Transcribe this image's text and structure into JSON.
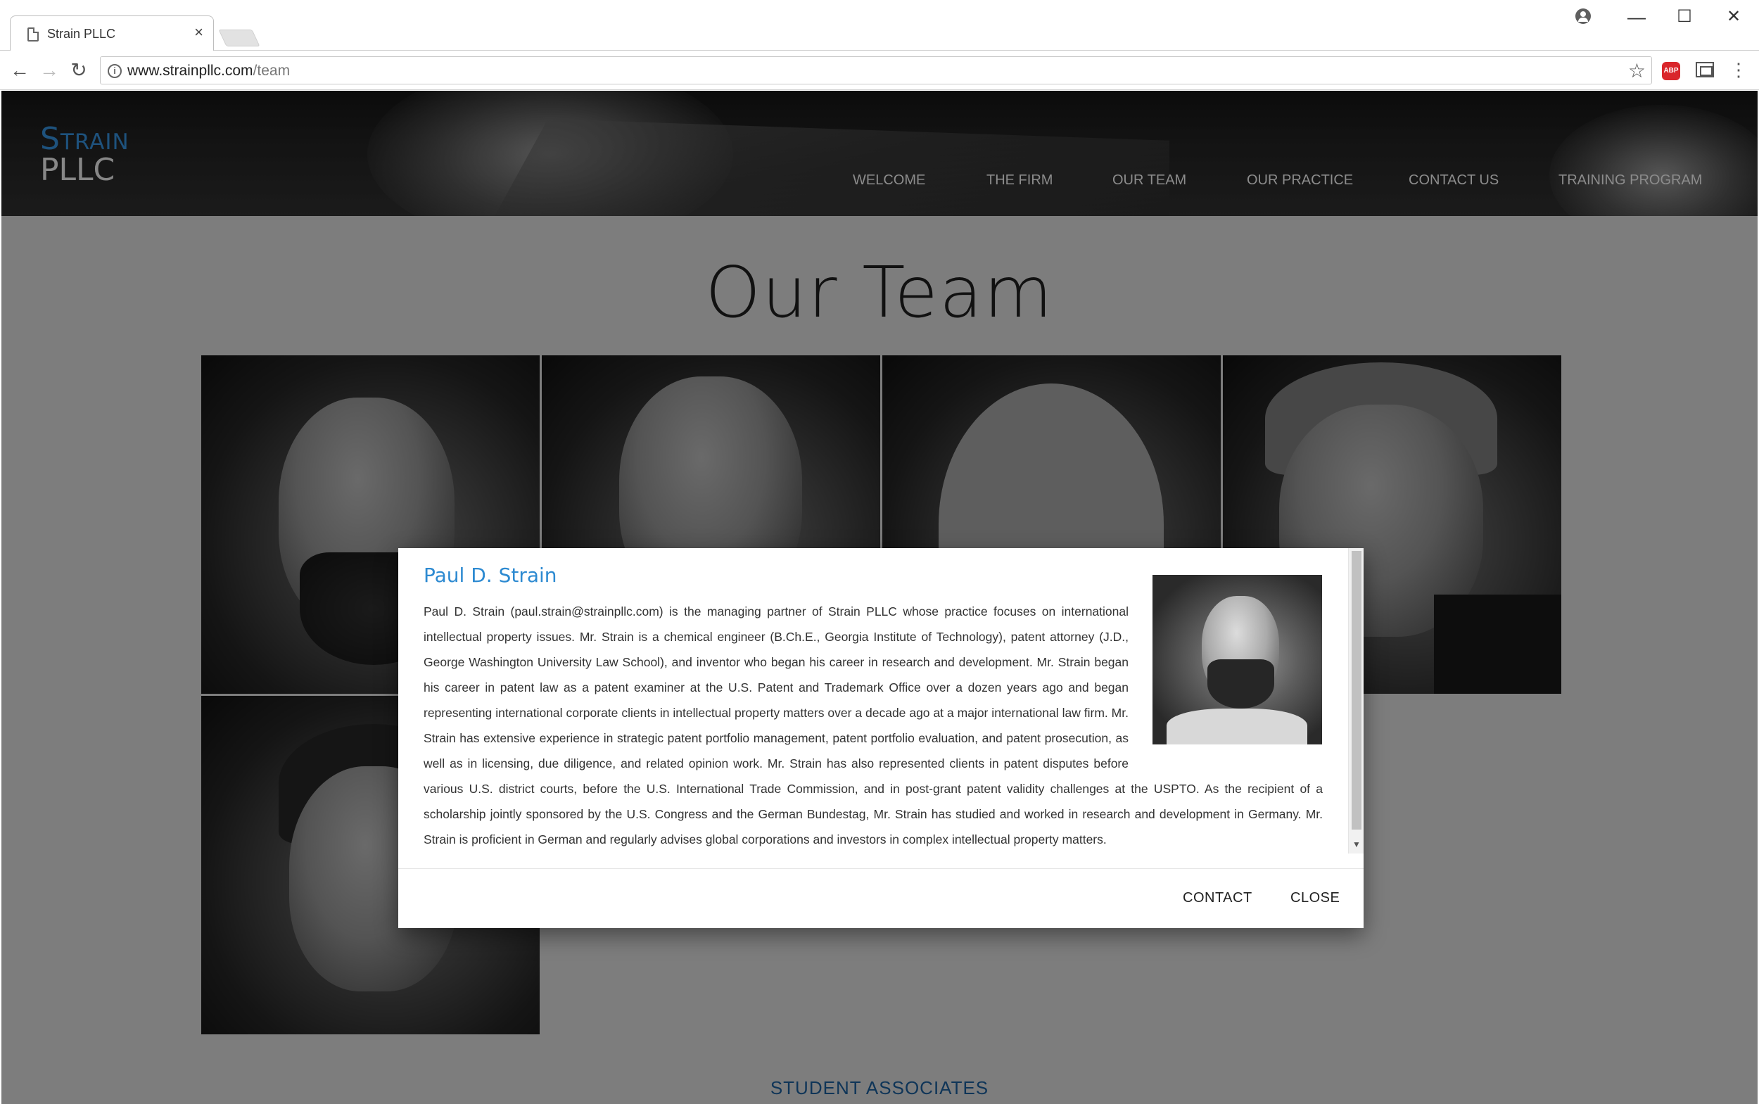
{
  "browser": {
    "tab_title": "Strain PLLC",
    "tab_close": "×",
    "url_host": "www.strainpllc.com",
    "url_path": "/team",
    "window_buttons": {
      "minimize": "—",
      "maximize": "☐",
      "close": "✕"
    },
    "nav_icons": {
      "back": "←",
      "forward": "→",
      "reload": "↻",
      "star": "☆",
      "menu": "⋮",
      "abp": "ABP"
    }
  },
  "site": {
    "logo_top": "Strain",
    "logo_bottom": "PLLC",
    "nav": [
      {
        "label": "WELCOME"
      },
      {
        "label": "THE FIRM"
      },
      {
        "label": "OUR TEAM"
      },
      {
        "label": "OUR PRACTICE"
      },
      {
        "label": "CONTACT US"
      },
      {
        "label": "TRAINING PROGRAM"
      }
    ]
  },
  "main": {
    "page_title": "Our Team",
    "student_associates": "STUDENT ASSOCIATES"
  },
  "modal": {
    "name": "Paul D. Strain",
    "bio": "Paul D. Strain (paul.strain@strainpllc.com) is the managing partner of Strain PLLC whose practice focuses on international intellectual property issues. Mr. Strain is a chemical engineer (B.Ch.E., Georgia Institute of Technology), patent attorney (J.D., George Washington University Law School), and inventor who began his career in research and development. Mr. Strain began his career in patent law as a patent examiner at the U.S. Patent and Trademark Office over a dozen years ago and began representing international corporate clients in intellectual property matters over a decade ago at a major international law firm. Mr. Strain has extensive experience in strategic patent portfolio management, patent portfolio evaluation, and patent prosecution, as well as in licensing, due diligence, and related opinion work. Mr. Strain has also represented clients in patent disputes before various U.S. district courts, before the U.S. International Trade Commission, and in post-grant patent validity challenges at the USPTO. As the recipient of a scholarship jointly sponsored by the U.S. Congress and the German Bundestag, Mr. Strain has studied and worked in research and development in Germany. Mr. Strain is proficient in German and regularly advises global corporations and investors in complex intellectual property matters.",
    "contact_label": "CONTACT",
    "close_label": "CLOSE"
  },
  "colors": {
    "accent_blue": "#2d8ad1",
    "logo_blue": "#2f7fc1",
    "link_blue": "#1f6ab1"
  }
}
